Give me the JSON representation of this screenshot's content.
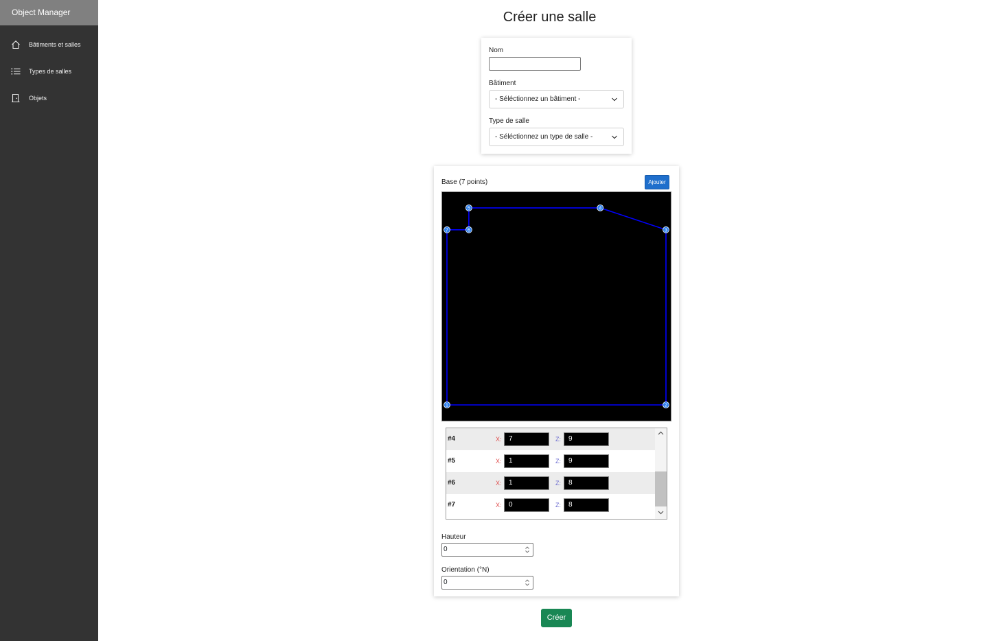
{
  "sidebar": {
    "brand": "Object Manager",
    "items": [
      {
        "label": "Bâtiments et salles",
        "icon": "home-icon"
      },
      {
        "label": "Types de salles",
        "icon": "list-icon"
      },
      {
        "label": "Objets",
        "icon": "door-icon"
      }
    ]
  },
  "page": {
    "title": "Créer une salle"
  },
  "form": {
    "nom_label": "Nom",
    "nom_value": "",
    "batiment_label": "Bâtiment",
    "batiment_selected": "- Séléctionnez un bâtiment -",
    "type_label": "Type de salle",
    "type_selected": "- Séléctionnez un type de salle -"
  },
  "base": {
    "title": "Base (7 points)",
    "add_label": "Ajouter",
    "points": [
      {
        "label": "1",
        "x": 0,
        "z": 0
      },
      {
        "label": "2",
        "x": 10,
        "z": 0
      },
      {
        "label": "3",
        "x": 10,
        "z": 8
      },
      {
        "label": "4",
        "x": 7,
        "z": 9
      },
      {
        "label": "5",
        "x": 1,
        "z": 9
      },
      {
        "label": "6",
        "x": 1,
        "z": 8
      },
      {
        "label": "7",
        "x": 0,
        "z": 8
      }
    ],
    "rows": [
      {
        "num": "#4",
        "x_label": "X:",
        "x": "7",
        "z_label": "Z:",
        "z": "9"
      },
      {
        "num": "#5",
        "x_label": "X:",
        "x": "1",
        "z_label": "Z:",
        "z": "9"
      },
      {
        "num": "#6",
        "x_label": "X:",
        "x": "1",
        "z_label": "Z:",
        "z": "8"
      },
      {
        "num": "#7",
        "x_label": "X:",
        "x": "0",
        "z_label": "Z:",
        "z": "8"
      }
    ],
    "scroll_fraction": 0.5
  },
  "hauteur": {
    "label": "Hauteur",
    "value": "0"
  },
  "orientation": {
    "label": "Orientation (°N)",
    "value": "0"
  },
  "create_label": "Créer",
  "colors": {
    "sidebar_bg": "#333333",
    "brand_bg": "#808080",
    "polygon_line": "#0000ff",
    "point_fill": "#2f80ed",
    "create_button": "#198754",
    "add_button": "#1f6fcc"
  }
}
